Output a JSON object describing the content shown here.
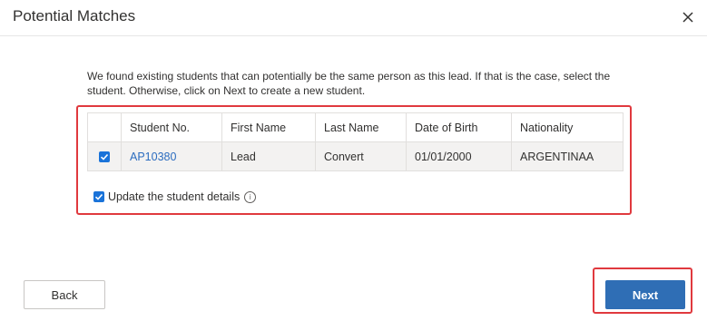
{
  "dialog": {
    "title": "Potential Matches",
    "close_icon": "close-icon"
  },
  "description": "We found existing students that can potentially be the same person as this lead. If that is the case, select the student. Otherwise, click on Next to create a new student.",
  "table": {
    "columns": [
      "",
      "Student No.",
      "First Name",
      "Last Name",
      "Date of Birth",
      "Nationality"
    ],
    "rows": [
      {
        "selected": true,
        "student_no": "AP10380",
        "first_name": "Lead",
        "last_name": "Convert",
        "date_of_birth": "01/01/2000",
        "nationality": "ARGENTINAA"
      }
    ]
  },
  "update_details": {
    "checked": true,
    "label": "Update the student details",
    "info_icon": "info-icon",
    "info_glyph": "i"
  },
  "buttons": {
    "back_label": "Back",
    "next_label": "Next"
  },
  "colors": {
    "accent": "#2f6eb5",
    "link": "#2b6cbf",
    "checkbox": "#1a73d9",
    "highlight": "#e0393e"
  }
}
